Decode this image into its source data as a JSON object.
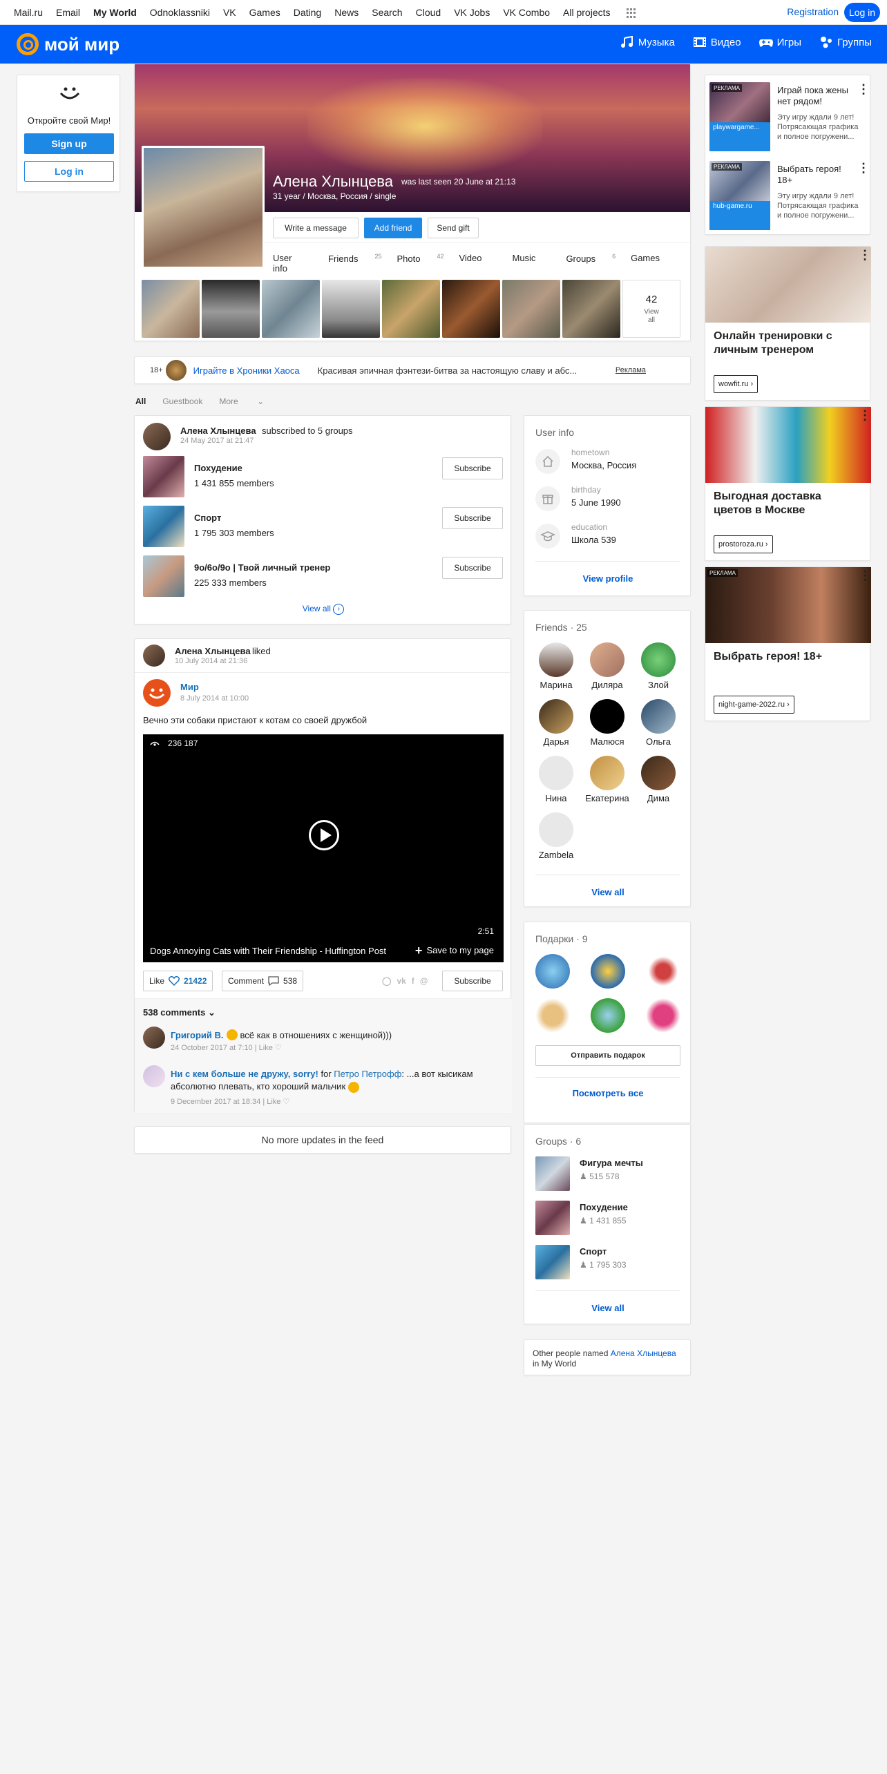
{
  "topbar": {
    "links": [
      "Mail.ru",
      "Email",
      "My World",
      "Odnoklassniki",
      "VK",
      "Games",
      "Dating",
      "News",
      "Search",
      "Cloud",
      "VK Jobs",
      "VK Combo",
      "All projects"
    ],
    "registration": "Registration",
    "login": "Log in"
  },
  "header": {
    "logo": "мой мир",
    "nav": [
      "Музыка",
      "Видео",
      "Игры",
      "Группы"
    ]
  },
  "promo": {
    "text": "Откройте свой Мир!",
    "signup": "Sign up",
    "login": "Log in"
  },
  "profile": {
    "name": "Алена Хлынцева",
    "last_seen": "was last seen 20 June at 21:13",
    "info": "31 year / Москва, Россия / single",
    "buttons": {
      "message": "Write a message",
      "add_friend": "Add friend",
      "gift": "Send gift"
    },
    "tabs": [
      {
        "label": "User info",
        "count": ""
      },
      {
        "label": "Friends",
        "count": "25"
      },
      {
        "label": "Photo",
        "count": "42"
      },
      {
        "label": "Video",
        "count": ""
      },
      {
        "label": "Music",
        "count": ""
      },
      {
        "label": "Groups",
        "count": "6"
      },
      {
        "label": "Games",
        "count": ""
      }
    ],
    "photos_count": "42",
    "view_all": "View all"
  },
  "ad_strip": {
    "age": "18+",
    "link": "Играйте в Хроники Хаоса",
    "text": "Красивая эпичная фэнтези-битва за настоящую славу и абс...",
    "label": "Реклама"
  },
  "feed_tabs": [
    "All",
    "Guestbook",
    "More"
  ],
  "post1": {
    "author": "Алена Хлынцева",
    "action": "subscribed to 5 groups",
    "date": "24 May 2017 at 21:47",
    "groups": [
      {
        "name": "Похудение",
        "members": "1 431 855 members"
      },
      {
        "name": "Спорт",
        "members": "1 795 303 members"
      },
      {
        "name": "9о/6о/9о | Твой личный тренер",
        "members": "225 333 members"
      }
    ],
    "subscribe": "Subscribe",
    "view_all": "View all"
  },
  "post2": {
    "author": "Алена Хлынцева",
    "action": "liked",
    "date": "10 July 2014 at 21:36",
    "source": "Мир",
    "source_date": "8 July 2014 at 10:00",
    "text": "Вечно эти собаки пристают к котам со своей дружбой",
    "views": "236 187",
    "duration": "2:51",
    "video_title": "Dogs Annoying Cats with Their Friendship - Huffington Post",
    "save": "Save to my page",
    "like_label": "Like",
    "likes": "21422",
    "comment_label": "Comment",
    "comments_count": "538",
    "subscribe": "Subscribe",
    "comments_header": "538 comments",
    "comments": [
      {
        "author": "Григорий В.",
        "text": "всё как в отношениях с женщиной)))",
        "date": "24 October 2017 at 7:10",
        "like": "Like"
      },
      {
        "author": "Ни с кем больше не дружу, sorry!",
        "for": "for",
        "to": "Петро Петрофф",
        "text": "...а вот кысикам абсолютно плевать, кто хороший мальчик",
        "date": "9 December 2017 at 18:34",
        "like": "Like"
      }
    ]
  },
  "no_more": "No more updates in the feed",
  "user_info": {
    "title": "User info",
    "rows": [
      {
        "label": "hometown",
        "value": "Москва, Россия"
      },
      {
        "label": "birthday",
        "value": "5 June 1990"
      },
      {
        "label": "education",
        "value": "Школа 539"
      }
    ],
    "view_profile": "View profile"
  },
  "friends": {
    "title": "Friends",
    "count": "25",
    "names": [
      "Марина",
      "Диляра",
      "Злой",
      "Дарья",
      "Малюся",
      "Ольга",
      "Нина",
      "Екатерина",
      "Дима",
      "Zambela"
    ],
    "view_all": "View all"
  },
  "gifts": {
    "title": "Подарки",
    "count": "9",
    "send": "Отправить подарок",
    "view_all": "Посмотреть все"
  },
  "groups": {
    "title": "Groups",
    "count": "6",
    "items": [
      {
        "name": "Фигура мечты",
        "count": "515 578"
      },
      {
        "name": "Похудение",
        "count": "1 431 855"
      },
      {
        "name": "Спорт",
        "count": "1 795 303"
      }
    ],
    "view_all": "View all"
  },
  "others": {
    "prefix": "Other people named",
    "name": "Алена Хлынцева",
    "suffix": "in My World"
  },
  "ads": {
    "small": [
      {
        "tag": "РЕКЛАМА",
        "title": "Играй пока жены нет рядом!",
        "desc": "Эту игру ждали 9 лет! Потрясающая графика и полное погружени...",
        "source": "playwargame..."
      },
      {
        "tag": "РЕКЛАМА",
        "title": "Выбрать героя! 18+",
        "desc": "Эту игру ждали 9 лет! Потрясающая графика и полное погружени...",
        "source": "hub-game.ru"
      }
    ],
    "big": [
      {
        "tag": "",
        "title": "Онлайн тренировки с личным тренером",
        "source": "wowfit.ru"
      },
      {
        "tag": "",
        "title": "Выгодная доставка цветов в Москве",
        "source": "prostoroza.ru"
      },
      {
        "tag": "РЕКЛАМА",
        "title": "Выбрать героя! 18+",
        "source": "night-game-2022.ru"
      }
    ]
  }
}
